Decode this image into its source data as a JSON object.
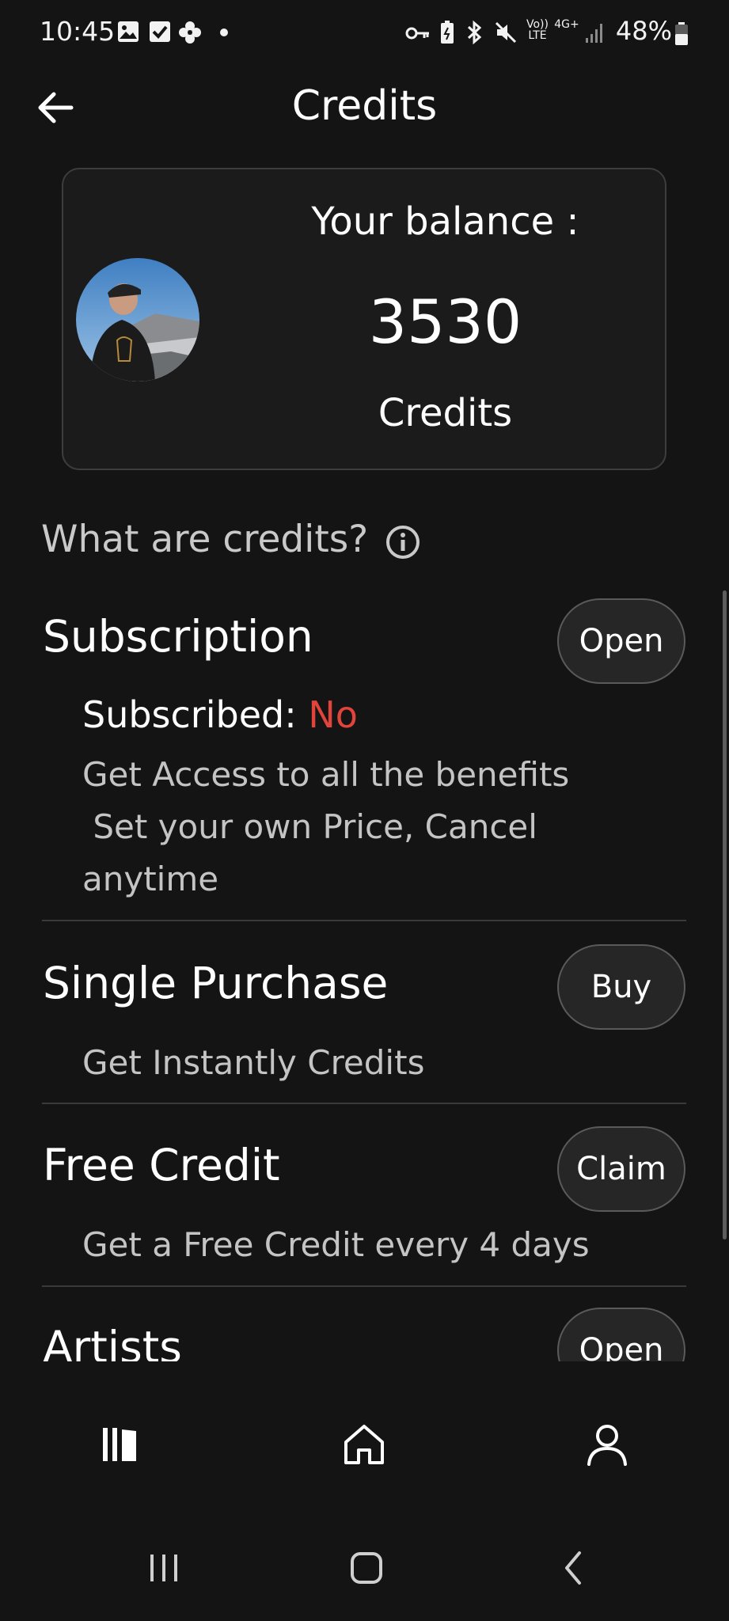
{
  "status_bar": {
    "time": "10:45",
    "battery": "48%",
    "icons": [
      "gallery-icon",
      "checkbox-icon",
      "flower-icon",
      "dot-icon",
      "key-icon",
      "battery-saver-icon",
      "bluetooth-icon",
      "mute-icon",
      "volte-icon",
      "4g-icon",
      "signal-icon",
      "battery-icon"
    ],
    "network_badge": "Vo)) LTE",
    "data_badge": "4G+"
  },
  "header": {
    "title": "Credits"
  },
  "balance": {
    "label": "Your balance :",
    "value": "3530",
    "unit": "Credits"
  },
  "what_are_credits": "What are credits?",
  "sections": {
    "subscription": {
      "title": "Subscription",
      "button": "Open",
      "status_label": "Subscribed:",
      "status_value": "No",
      "description_lines": [
        "Get Access to all the benefits",
        " Set your own Price, Cancel",
        "anytime"
      ]
    },
    "single_purchase": {
      "title": "Single Purchase",
      "button": "Buy",
      "description": "Get Instantly Credits"
    },
    "free_credit": {
      "title": "Free Credit",
      "button": "Claim",
      "description": "Get a Free Credit every 4 days"
    },
    "artists": {
      "title": "Artists",
      "button": "Open"
    }
  },
  "colors": {
    "background": "#141414",
    "accent_no": "#e0443a"
  },
  "bottom_nav": [
    "library-icon",
    "home-icon",
    "profile-icon"
  ],
  "system_nav": [
    "recents-icon",
    "home-button-icon",
    "back-icon"
  ]
}
